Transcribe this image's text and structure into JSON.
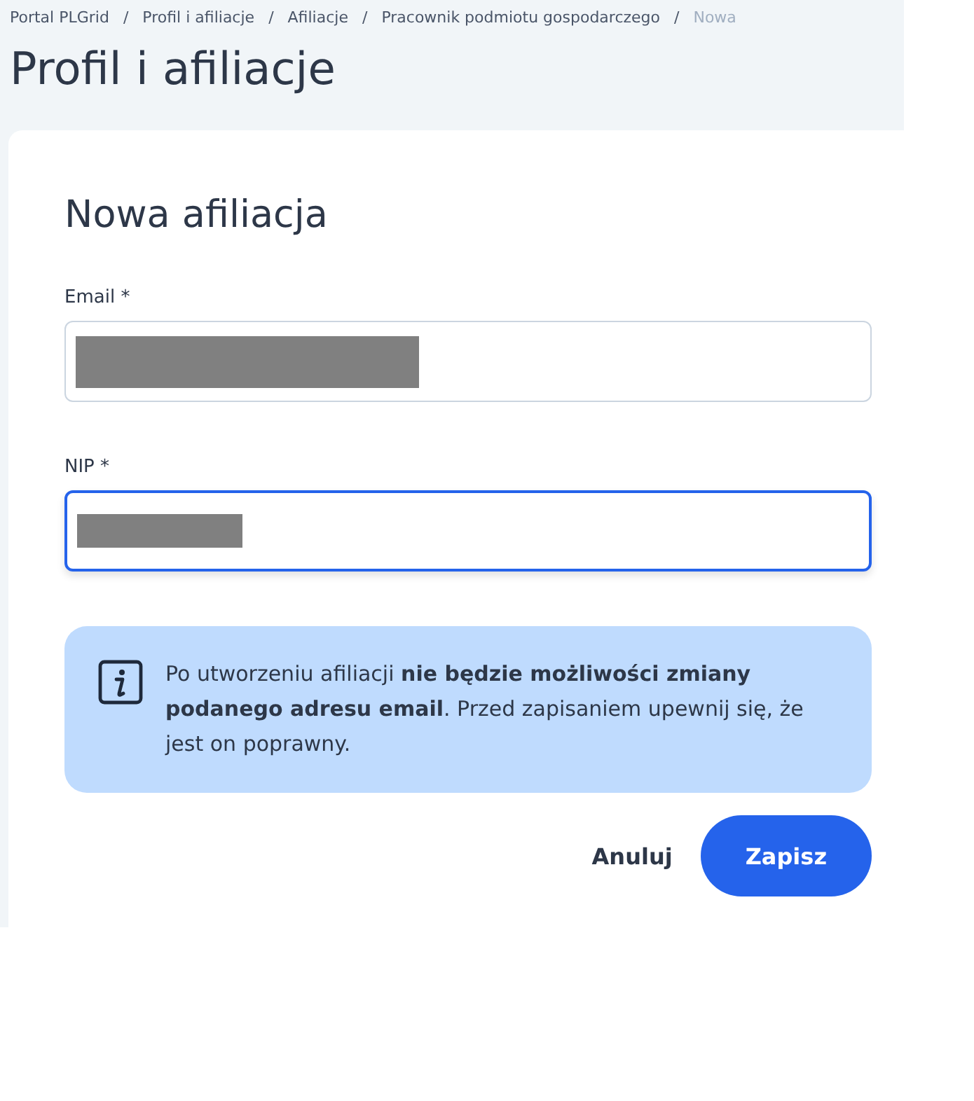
{
  "breadcrumb": [
    {
      "label": "Portal PLGrid",
      "current": false
    },
    {
      "separator": "/",
      "label": "Profil i afiliacje",
      "current": false
    },
    {
      "separator": "/",
      "label": "Afiliacje",
      "current": false
    },
    {
      "separator": "/",
      "label": "Pracownik podmiotu gospodarczego",
      "current": false
    },
    {
      "separator": "/",
      "label": "Nowa",
      "current": true
    }
  ],
  "page_title": "Profil i afiliacje",
  "form": {
    "title": "Nowa afiliacja",
    "fields": [
      {
        "label": "Email *",
        "redacted": true,
        "focused": false
      },
      {
        "label": "NIP *",
        "redacted": true,
        "focused": true
      }
    ],
    "notice": "Po utworzeniu afiliacji **nie będzie możliwości zmiany podanego adresu email**. Przed zapisaniem upewnij się, że jest on poprawny.",
    "buttons": [
      {
        "label": "Anuluj",
        "kind": "secondary"
      },
      {
        "label": "Zapisz",
        "kind": "primary"
      }
    ]
  }
}
